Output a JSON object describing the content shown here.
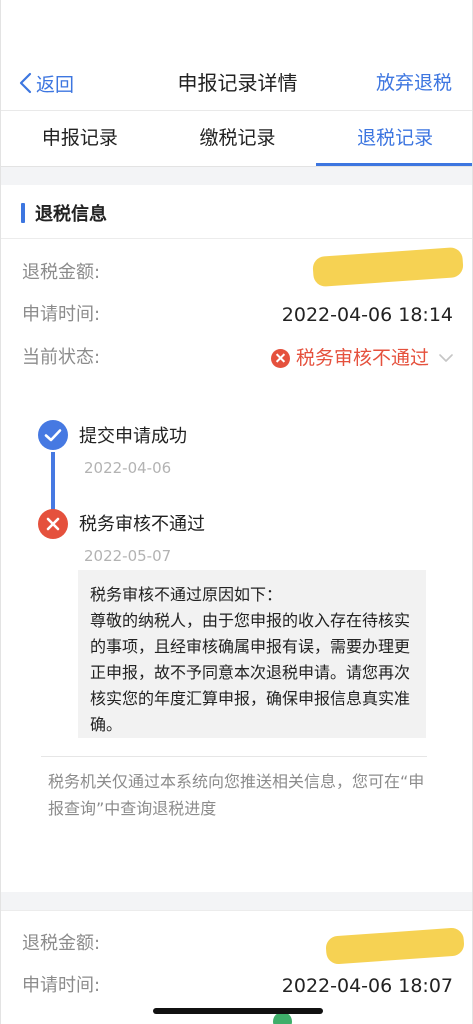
{
  "nav": {
    "back_label": "返回",
    "title": "申报记录详情",
    "action_label": "放弃退税"
  },
  "tabs": [
    {
      "label": "申报记录",
      "active": false
    },
    {
      "label": "缴税记录",
      "active": false
    },
    {
      "label": "退税记录",
      "active": true
    }
  ],
  "section": {
    "title": "退税信息"
  },
  "record1": {
    "amount_label": "退税金额:",
    "time_label": "申请时间:",
    "time_value": "2022-04-06 18:14",
    "status_label": "当前状态:",
    "status_value": "税务审核不通过"
  },
  "timeline": [
    {
      "title": "提交申请成功",
      "date": "2022-04-06",
      "state": "success"
    },
    {
      "title": "税务审核不通过",
      "date": "2022-05-07",
      "state": "failed"
    }
  ],
  "reason": {
    "text": "税务审核不通过原因如下：\n尊敬的纳税人，由于您申报的收入存在待核实的事项，且经审核确属申报有误，需要办理更正申报，故不予同意本次退税申请。请您再次核实您的年度汇算申报，确保申报信息真实准确。"
  },
  "notice": {
    "text": "税务机关仅通过本系统向您推送相关信息，您可在“申报查询”中查询退税进度"
  },
  "record2": {
    "amount_label": "退税金额:",
    "time_label": "申请时间:",
    "time_value": "2022-04-06 18:07"
  },
  "colors": {
    "accent": "#3d76e0",
    "error": "#e5513d",
    "success": "#3fae6a",
    "muted": "#8c8c8c"
  },
  "icons": {
    "back": "chevron-left-icon",
    "status_fail": "error-circle-icon",
    "expand": "chevron-down-icon",
    "step_ok": "check-circle-icon",
    "step_fail": "close-circle-icon"
  }
}
